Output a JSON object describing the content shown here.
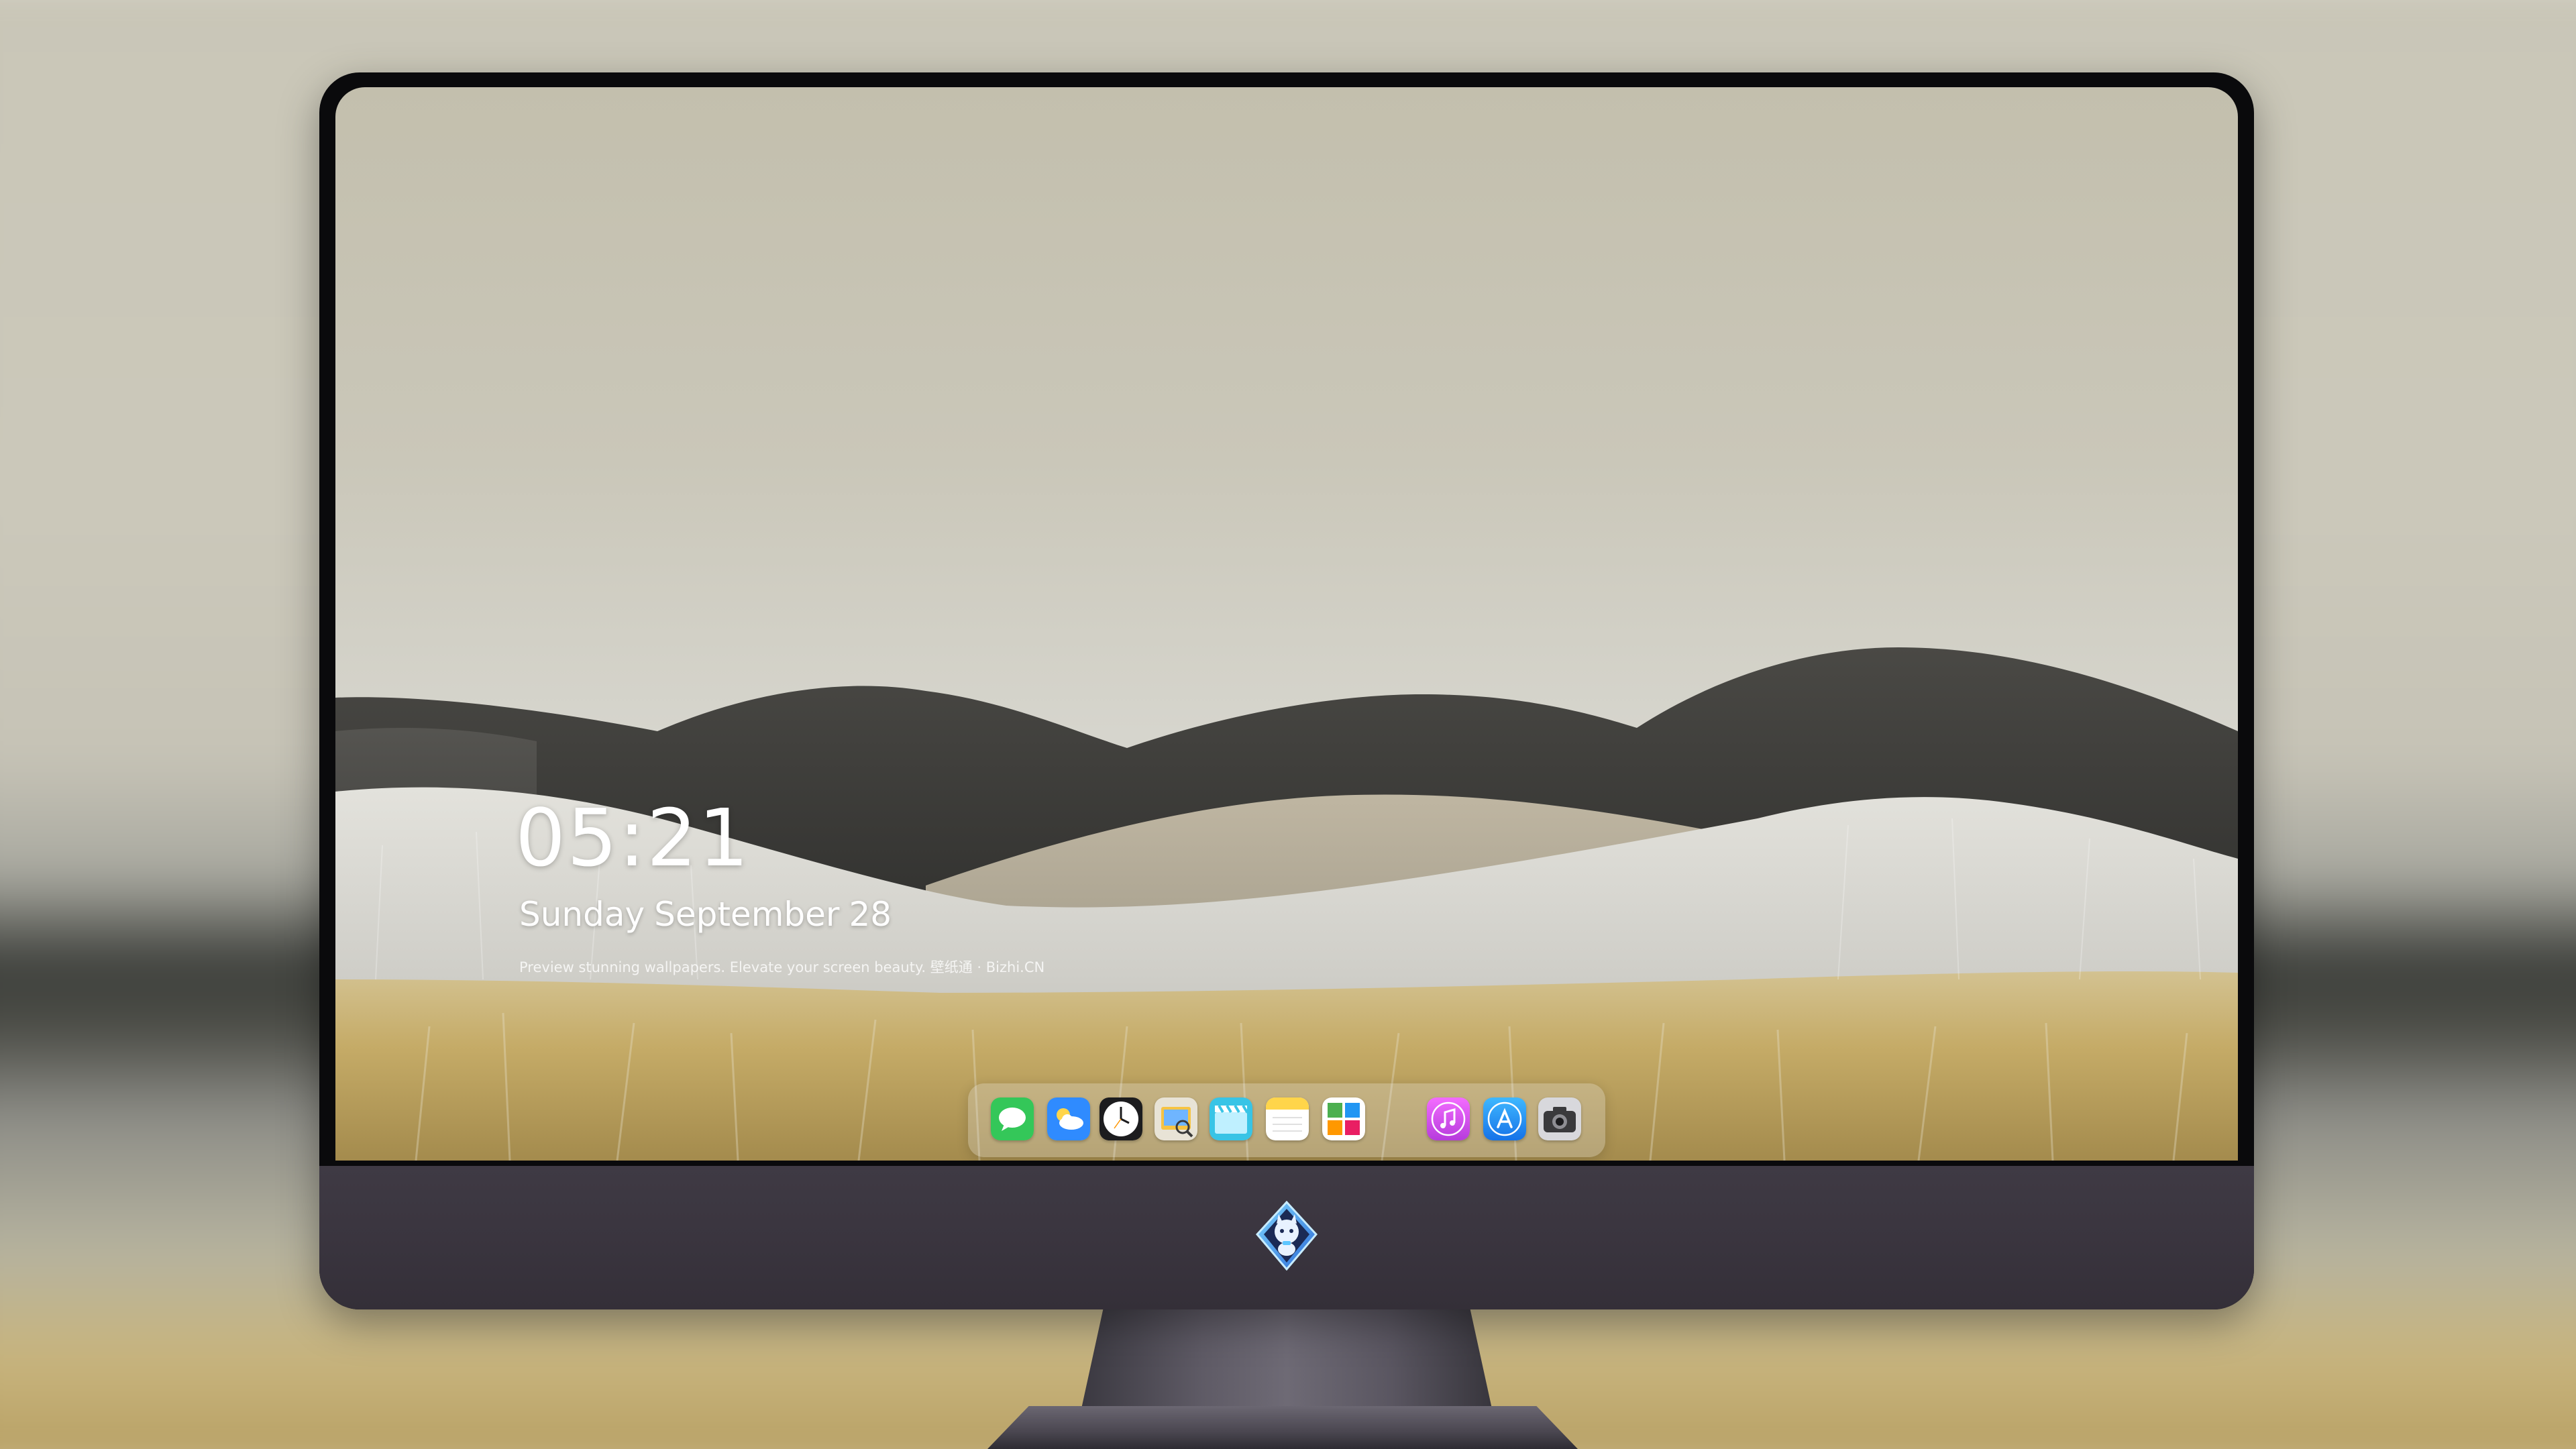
{
  "lockscreen": {
    "time": "05:21",
    "weekday": "Sunday",
    "month": "September",
    "day": "28",
    "tagline": "Preview stunning wallpapers. Elevate your screen beauty. 壁纸通 · Bizhi.CN"
  },
  "dock": {
    "apps": [
      {
        "name": "messages-icon",
        "color": "#34c759"
      },
      {
        "name": "weather-icon",
        "color": "#2f8bff"
      },
      {
        "name": "clock-icon",
        "color": "#1c1c1e"
      },
      {
        "name": "preview-icon",
        "color": "#f6c343"
      },
      {
        "name": "clips-icon",
        "color": "#38c4e6"
      },
      {
        "name": "notes-icon",
        "color": "#ffd54a"
      },
      {
        "name": "photo-collage-icon",
        "color": "#ffffff"
      },
      {
        "name": "itunes-icon",
        "color": "#e050e8"
      },
      {
        "name": "app-store-icon",
        "color": "#1a8ef8"
      },
      {
        "name": "camera-icon",
        "color": "#8e8e93"
      }
    ]
  },
  "colors": {
    "sky": "#c9c6b6",
    "hills": "#3e3d3a",
    "grass-gold": "#c7a961",
    "grass-silver": "#d7d6d2",
    "bezel": "#0a0a0c",
    "chin": "#3c3741"
  }
}
